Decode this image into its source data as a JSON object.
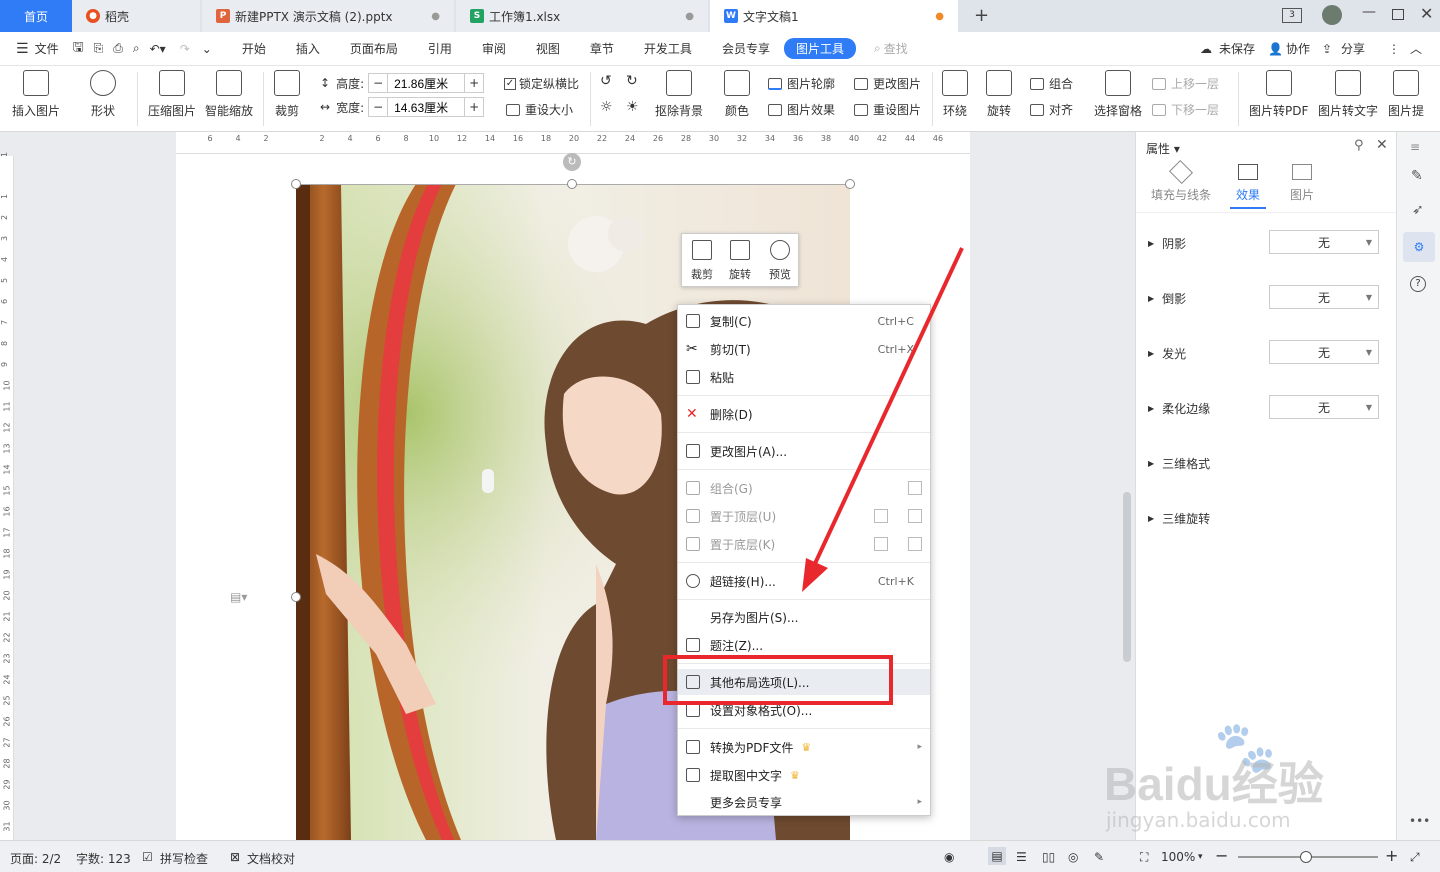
{
  "tabs": [
    {
      "label": "首页",
      "active": true,
      "color": "#2f7cf6"
    },
    {
      "label": "稻壳",
      "icon": "docer-icon",
      "color": "#e8501f"
    },
    {
      "label": "新建PPTX 演示文稿 (2).pptx",
      "icon": "P",
      "color": "#e0653c"
    },
    {
      "label": "工作簿1.xlsx",
      "icon": "S",
      "color": "#23a362"
    },
    {
      "label": "文字文稿1",
      "icon": "W",
      "color": "#2f7cf6",
      "active_doc": true
    }
  ],
  "tabbar_right": {
    "window_count": "3"
  },
  "menu": {
    "file": "文件",
    "items": [
      "开始",
      "插入",
      "页面布局",
      "引用",
      "审阅",
      "视图",
      "章节",
      "开发工具",
      "会员专享"
    ],
    "active": "图片工具",
    "search": "查找",
    "unsaved": "未保存",
    "collab": "协作",
    "share": "分享"
  },
  "ribbon": {
    "insert_pic": "插入图片",
    "shape": "形状",
    "compress": "压缩图片",
    "smart_scale": "智能缩放",
    "crop": "裁剪",
    "height_label": "高度:",
    "height_value": "21.86厘米",
    "width_label": "宽度:",
    "width_value": "14.63厘米",
    "lock_ratio": "锁定纵横比",
    "reset_size": "重设大小",
    "remove_bg": "抠除背景",
    "color": "颜色",
    "outline": "图片轮廓",
    "effect": "图片效果",
    "change_pic": "更改图片",
    "reset_pic": "重设图片",
    "wrap": "环绕",
    "rotate": "旋转",
    "group": "组合",
    "align": "对齐",
    "select_pane": "选择窗格",
    "bring_forward": "上移一层",
    "send_backward": "下移一层",
    "to_pdf": "图片转PDF",
    "to_text": "图片转文字",
    "extract": "图片提"
  },
  "ruler_h": [
    "6",
    "4",
    "2",
    "",
    "2",
    "4",
    "6",
    "8",
    "10",
    "12",
    "14",
    "16",
    "18",
    "20",
    "22",
    "24",
    "26",
    "28",
    "30",
    "32",
    "34",
    "36",
    "38",
    "40",
    "42",
    "44",
    "46"
  ],
  "ruler_v": [
    "1",
    "",
    "1",
    "2",
    "3",
    "4",
    "5",
    "6",
    "7",
    "8",
    "9",
    "10",
    "11",
    "12",
    "13",
    "14",
    "15",
    "16",
    "17",
    "18",
    "19",
    "20",
    "21",
    "22",
    "23",
    "24",
    "25",
    "26",
    "27",
    "28",
    "29",
    "30",
    "31"
  ],
  "mini_toolbar": {
    "crop": "裁剪",
    "rotate": "旋转",
    "preview": "预览"
  },
  "context_menu": [
    {
      "label": "复制(C)",
      "shortcut": "Ctrl+C",
      "icon": "copy-icon"
    },
    {
      "label": "剪切(T)",
      "shortcut": "Ctrl+X",
      "icon": "cut-icon"
    },
    {
      "label": "粘贴",
      "shortcut": "",
      "icon": "paste-icon"
    },
    {
      "label": "删除(D)",
      "shortcut": "",
      "icon": "delete-icon"
    },
    {
      "label": "更改图片(A)...",
      "shortcut": "",
      "icon": "change-picture-icon"
    },
    {
      "label": "组合(G)",
      "shortcut": "",
      "icon": "group-icon",
      "disabled": true
    },
    {
      "label": "置于顶层(U)",
      "shortcut": "",
      "icon": "bring-to-front-icon",
      "disabled": true
    },
    {
      "label": "置于底层(K)",
      "shortcut": "",
      "icon": "send-to-back-icon",
      "disabled": true
    },
    {
      "label": "超链接(H)...",
      "shortcut": "Ctrl+K",
      "icon": "hyperlink-icon"
    },
    {
      "label": "另存为图片(S)...",
      "shortcut": "",
      "icon": ""
    },
    {
      "label": "题注(Z)...",
      "shortcut": "",
      "icon": "caption-icon"
    },
    {
      "label": "其他布局选项(L)...",
      "shortcut": "",
      "icon": "layout-options-icon",
      "hover": true
    },
    {
      "label": "设置对象格式(O)...",
      "shortcut": "",
      "icon": "format-object-icon"
    },
    {
      "label": "转换为PDF文件",
      "shortcut": "",
      "icon": "pdf-icon",
      "vip": true,
      "submenu": true
    },
    {
      "label": "提取图中文字",
      "shortcut": "",
      "icon": "ocr-icon",
      "vip": true
    },
    {
      "label": "更多会员专享",
      "shortcut": "",
      "icon": "",
      "submenu": true
    }
  ],
  "panel": {
    "title": "属性",
    "tabs": [
      "填充与线条",
      "效果",
      "图片"
    ],
    "active_tab": "效果",
    "rows": [
      {
        "label": "阴影",
        "value": "无"
      },
      {
        "label": "倒影",
        "value": "无"
      },
      {
        "label": "发光",
        "value": "无"
      },
      {
        "label": "柔化边缘",
        "value": "无"
      },
      {
        "label": "三维格式"
      },
      {
        "label": "三维旋转"
      }
    ]
  },
  "status": {
    "page": "页面: 2/2",
    "words": "字数: 123",
    "spell": "拼写检查",
    "proof": "文档校对",
    "zoom": "100%"
  },
  "watermark": {
    "brand": "Baidu经验",
    "url": "jingyan.baidu.com"
  },
  "colors": {
    "accent": "#2f7cf6",
    "highlight": "#e8282d",
    "vip": "#f2b230"
  }
}
